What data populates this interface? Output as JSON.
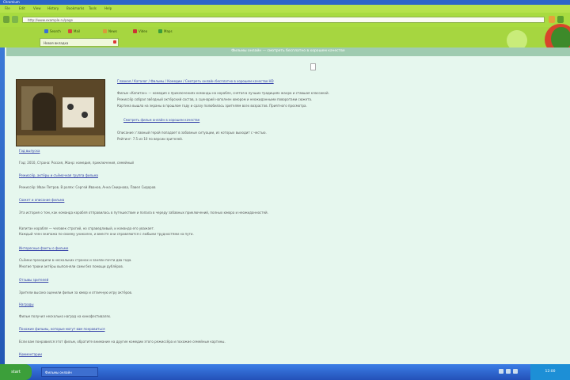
{
  "colors": {
    "chrome": "#a8db40",
    "page_bg": "#e6f7ee",
    "link": "#3340a8",
    "taskbar": "#2a62c8",
    "banner": "#9fcbb0"
  },
  "window": {
    "title": "Chromium"
  },
  "menu": [
    "File",
    "Edit",
    "View",
    "History",
    "Bookmarks",
    "Tools",
    "Help"
  ],
  "address": {
    "url": "http://www.example.ru/page"
  },
  "bookmarks": [
    {
      "label": "Search",
      "icon": "search-icon",
      "color": "#3a6fd8"
    },
    {
      "label": "Mail",
      "icon": "mail-icon",
      "color": "#d8473a"
    },
    {
      "label": "News",
      "icon": "news-icon",
      "color": "#d89b3a"
    },
    {
      "label": "Video",
      "icon": "video-icon",
      "color": "#c33"
    },
    {
      "label": "Maps",
      "icon": "map-icon",
      "color": "#3a9d3a"
    }
  ],
  "tab": {
    "label": "Новая вкладка"
  },
  "banner": {
    "text": "Фильмы онлайн — смотреть бесплатно в хорошем качестве"
  },
  "article": {
    "intro_link": "Главная / Каталог / Фильмы / Комедии / Смотреть онлайн бесплатно в хорошем качестве HD",
    "p1": "Фильм «Капитан» — комедия о приключениях команды на корабле, снятая в лучших традициях жанра и ставшая классикой.",
    "p2": "Режиссёр собрал звёздный актёрский состав, а сценарий наполнен юмором и неожиданными поворотами сюжета.",
    "p3": "Картина вышла на экраны в прошлом году и сразу полюбилась зрителям всех возрастов. Приятного просмотра.",
    "sub_link": "Смотреть фильм онлайн в хорошем качестве",
    "p4": "Описание: главный герой попадает в забавные ситуации, из которых выходит с честью.",
    "p5": "Рейтинг: 7.5 из 10 по версии зрителей.",
    "h1": "Год выпуска",
    "t1": "Год: 2010, Страна: Россия, Жанр: комедия, приключения, семейный",
    "h2": "Режиссёр, актёры и съёмочная группа фильма",
    "t2": "Режиссёр: Иван Петров. В ролях: Сергей Иванов, Анна Смирнова, Павел Сидоров",
    "h3": "Сюжет и описание фильма",
    "t3": "Эта история о том, как команда корабля отправилась в путешествие и попала в череду забавных приключений, полных юмора и неожиданностей.",
    "t4a": "Капитан корабля — человек строгий, но справедливый, и команда его уважает.",
    "t4b": "Каждый член экипажа по-своему уникален, и вместе они справляются с любыми трудностями на пути.",
    "h4": "Интересные факты о фильме",
    "t5a": "Съёмки проходили в нескольких странах и заняли почти два года.",
    "t5b": "Многие трюки актёры выполняли сами без помощи дублёров.",
    "h5": "Отзывы зрителей",
    "t6": "Зрители высоко оценили фильм за юмор и отличную игру актёров.",
    "h6": "Награды",
    "t7": "Фильм получил несколько наград на кинофестивалях.",
    "h7": "Похожие фильмы, которые могут вам понравиться",
    "t8": "Если вам понравился этот фильм, обратите внимание на другие комедии этого режиссёра и похожие семейные картины.",
    "h8": "Комментарии"
  },
  "taskbar": {
    "start": "start",
    "task": "Фильмы онлайн",
    "clock": "12:00"
  }
}
